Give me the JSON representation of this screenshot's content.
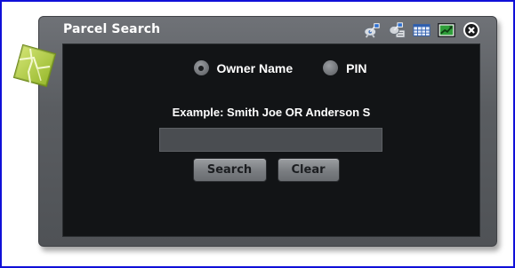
{
  "widget": {
    "title": "Parcel Search",
    "toolbar": {
      "icons": [
        "satellite-dish-icon",
        "satellite-map-icon",
        "table-icon",
        "chart-trend-icon",
        "close-icon"
      ]
    }
  },
  "search": {
    "options": [
      {
        "label": "Owner Name",
        "selected": true
      },
      {
        "label": "PIN",
        "selected": false
      }
    ],
    "example_text": "Example: Smith Joe OR Anderson S",
    "input_value": "",
    "input_placeholder": "",
    "search_label": "Search",
    "clear_label": "Clear"
  },
  "colors": {
    "frame_border": "#1010d8",
    "panel_bg": "#121416",
    "widget_bg": "#5a5d61",
    "badge_green": "#b8d23a"
  }
}
